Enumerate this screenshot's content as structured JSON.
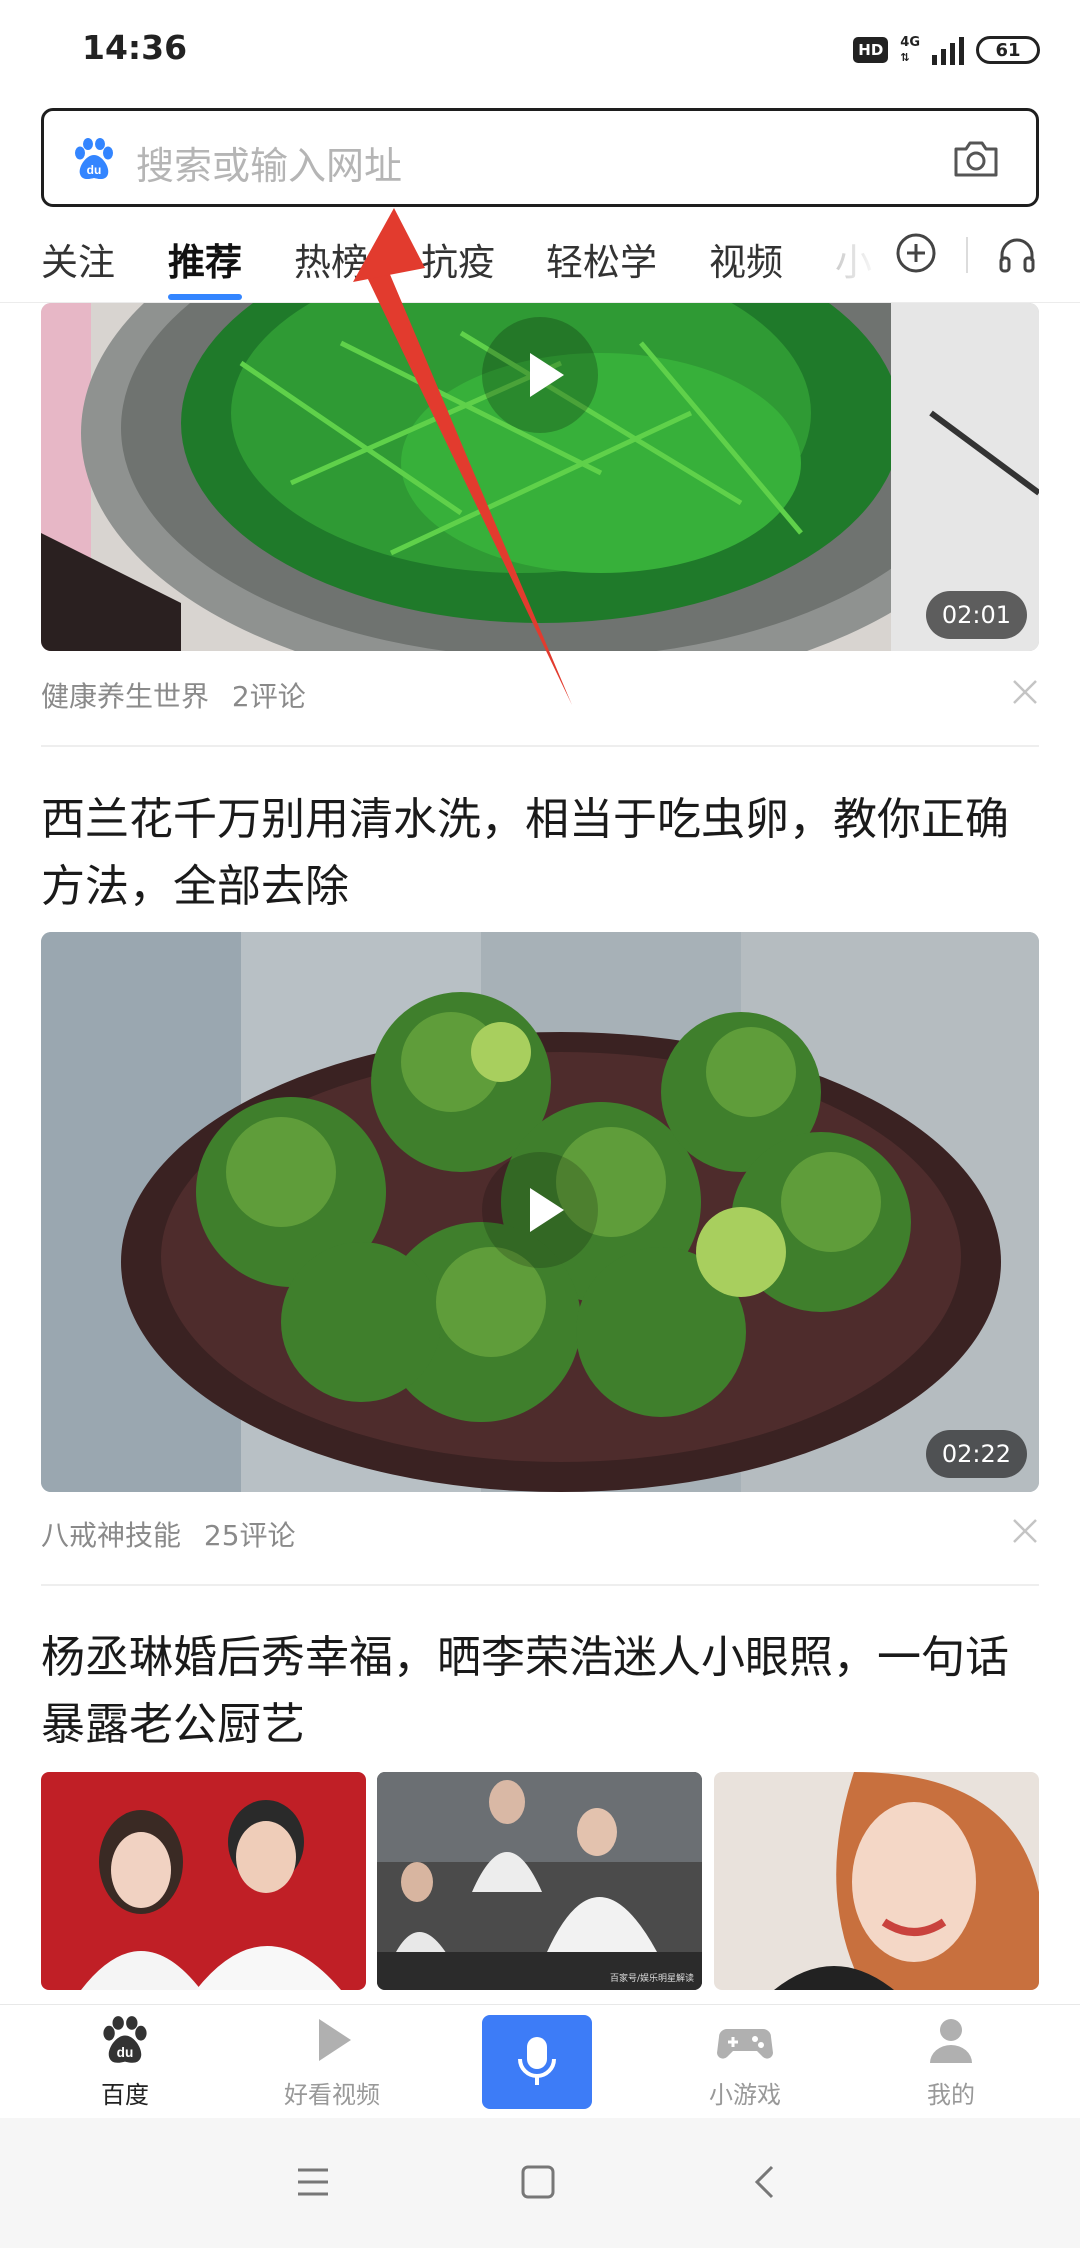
{
  "status_bar": {
    "time": "14:36",
    "hd": "HD",
    "network": "4G",
    "battery": "61"
  },
  "search": {
    "placeholder": "搜索或输入网址"
  },
  "tabs": [
    {
      "label": "关注"
    },
    {
      "label": "推荐"
    },
    {
      "label": "热榜"
    },
    {
      "label": "抗疫"
    },
    {
      "label": "轻松学"
    },
    {
      "label": "视频"
    },
    {
      "label": "小"
    }
  ],
  "feed": {
    "item1": {
      "source": "健康养生世界",
      "comments": "2评论",
      "duration": "02:01"
    },
    "item2": {
      "title": "西兰花千万别用清水洗，相当于吃虫卵，教你正确方法，全部去除",
      "source": "八戒神技能",
      "comments": "25评论",
      "duration": "02:22"
    },
    "item3": {
      "title": "杨丞琳婚后秀幸福，晒李荣浩迷人小眼照，一句话暴露老公厨艺",
      "thumb_caption": "百家号/娱乐明星解读"
    }
  },
  "bottom_nav": [
    {
      "label": "百度",
      "icon": "baidu-paw-icon"
    },
    {
      "label": "好看视频",
      "icon": "play-icon"
    },
    {
      "label": "",
      "icon": "microphone-icon"
    },
    {
      "label": "小游戏",
      "icon": "gamepad-icon"
    },
    {
      "label": "我的",
      "icon": "user-icon"
    }
  ],
  "colors": {
    "accent": "#3385ff",
    "mic_button": "#3d7cf7",
    "annotation_arrow": "#e23b2e"
  }
}
